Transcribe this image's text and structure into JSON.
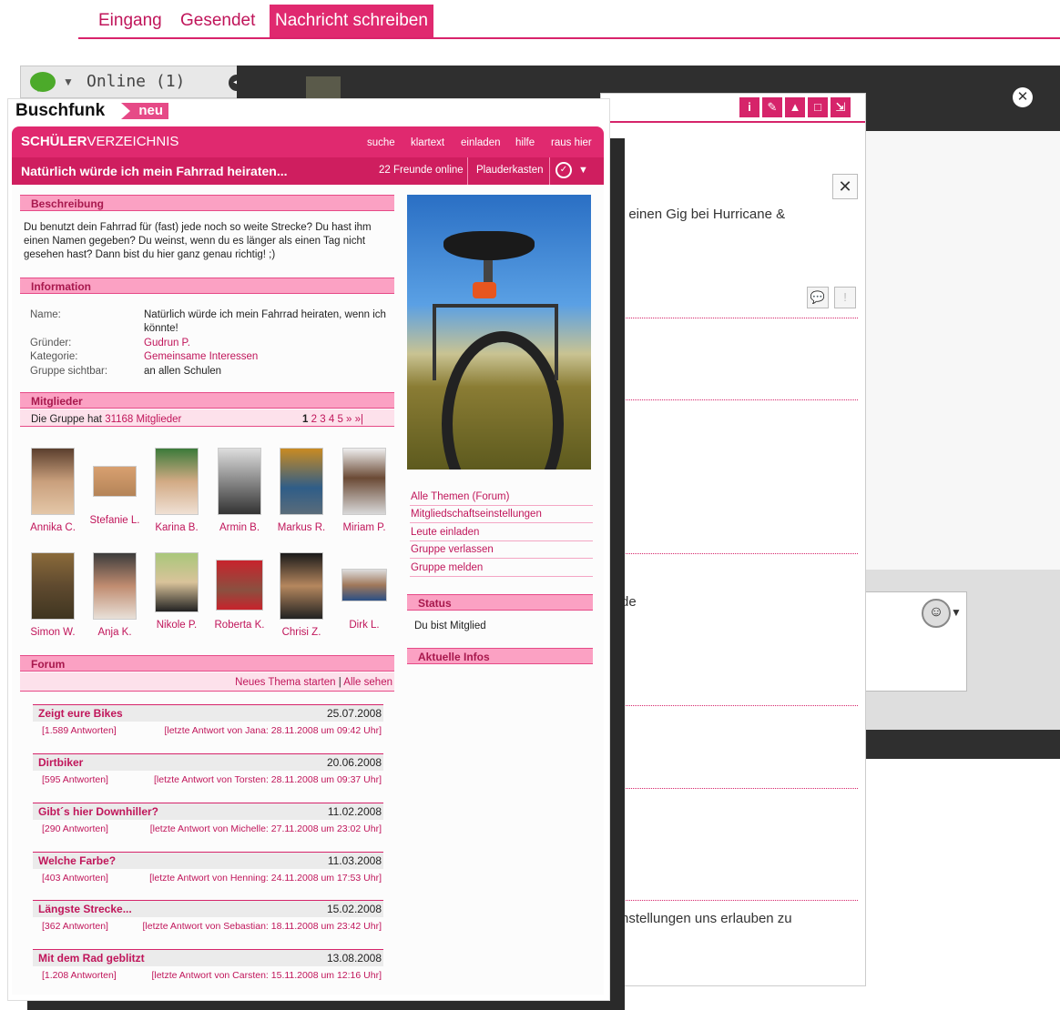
{
  "top_tabs": [
    "Eingang",
    "Gesendet",
    "Nachricht schreiben"
  ],
  "chat": {
    "label": "Online (1)"
  },
  "back_window": {
    "line1": "t einen Gig bei Hurricane &",
    "line2": "de",
    "line3": "nstellungen uns erlauben zu"
  },
  "buschfunk": {
    "title": "Buschfunk",
    "badge": "neu"
  },
  "header": {
    "brand_bold": "SCHÜLER",
    "brand_rest": "VERZEICHNIS",
    "nav": [
      "suche",
      "klartext",
      "einladen",
      "hilfe",
      "raus hier"
    ]
  },
  "group_bar": {
    "title": "Natürlich würde ich mein Fahrrad heiraten...",
    "friends_online": "22 Freunde online",
    "chat_room": "Plauderkasten"
  },
  "description": {
    "heading": "Beschreibung",
    "text": "Du benutzt dein Fahrrad für (fast) jede noch so weite Strecke? Du hast ihm einen Namen gegeben? Du weinst, wenn du es länger als einen Tag nicht gesehen hast? Dann bist du hier ganz genau richtig! ;)"
  },
  "information": {
    "heading": "Information",
    "rows": [
      {
        "label": "Name:",
        "value": "Natürlich würde ich mein Fahrrad heiraten, wenn ich könnte!"
      },
      {
        "label": "Gründer:",
        "value": "Gudrun P."
      },
      {
        "label": "Kategorie:",
        "value": "Gemeinsame Interessen"
      },
      {
        "label": "Gruppe sichtbar:",
        "value": "an allen Schulen"
      }
    ]
  },
  "members": {
    "heading": "Mitglieder",
    "count_prefix": "Die Gruppe hat",
    "count_link": "31168 Mitglieder",
    "pages": [
      "1",
      "2",
      "3",
      "4",
      "5",
      "»",
      "»|"
    ],
    "list": [
      "Annika C.",
      "Stefanie L.",
      "Karina B.",
      "Armin B.",
      "Markus R.",
      "Miriam P.",
      "Simon W.",
      "Anja K.",
      "Nikole P.",
      "Roberta K.",
      "Chrisi Z.",
      "Dirk L."
    ]
  },
  "forum": {
    "heading": "Forum",
    "new_topic": "Neues Thema starten",
    "separator": "|",
    "see_all": "Alle sehen",
    "posts": [
      {
        "title": "Zeigt eure Bikes",
        "date": "25.07.2008",
        "replies": "[1.589 Antworten]",
        "last": "[letzte Antwort von Jana: 28.11.2008 um 09:42 Uhr]"
      },
      {
        "title": "Dirtbiker",
        "date": "20.06.2008",
        "replies": "[595 Antworten]",
        "last": "[letzte Antwort von Torsten: 28.11.2008 um 09:37 Uhr]"
      },
      {
        "title": "Gibt´s hier Downhiller?",
        "date": "11.02.2008",
        "replies": "[290 Antworten]",
        "last": "[letzte Antwort von Michelle: 27.11.2008 um 23:02 Uhr]"
      },
      {
        "title": "Welche Farbe?",
        "date": "11.03.2008",
        "replies": "[403 Antworten]",
        "last": "[letzte Antwort von Henning: 24.11.2008 um 17:53 Uhr]"
      },
      {
        "title": "Längste Strecke...",
        "date": "15.02.2008",
        "replies": "[362 Antworten]",
        "last": "[letzte Antwort von Sebastian: 18.11.2008 um 23:42 Uhr]"
      },
      {
        "title": "Mit dem Rad geblitzt",
        "date": "13.08.2008",
        "replies": "[1.208 Antworten]",
        "last": "[letzte Antwort von Carsten: 15.11.2008 um 12:16 Uhr]"
      }
    ]
  },
  "sidebar": {
    "links": [
      "Alle Themen (Forum)",
      "Mitgliedschaftseinstellungen",
      "Leute einladen",
      "Gruppe verlassen",
      "Gruppe melden"
    ],
    "status_heading": "Status",
    "status_text": "Du bist Mitglied",
    "news_heading": "Aktuelle Infos"
  },
  "colors": {
    "accent": "#e0296f",
    "accent_dark": "#cf1e5f",
    "section_bg": "#fba1c3"
  }
}
